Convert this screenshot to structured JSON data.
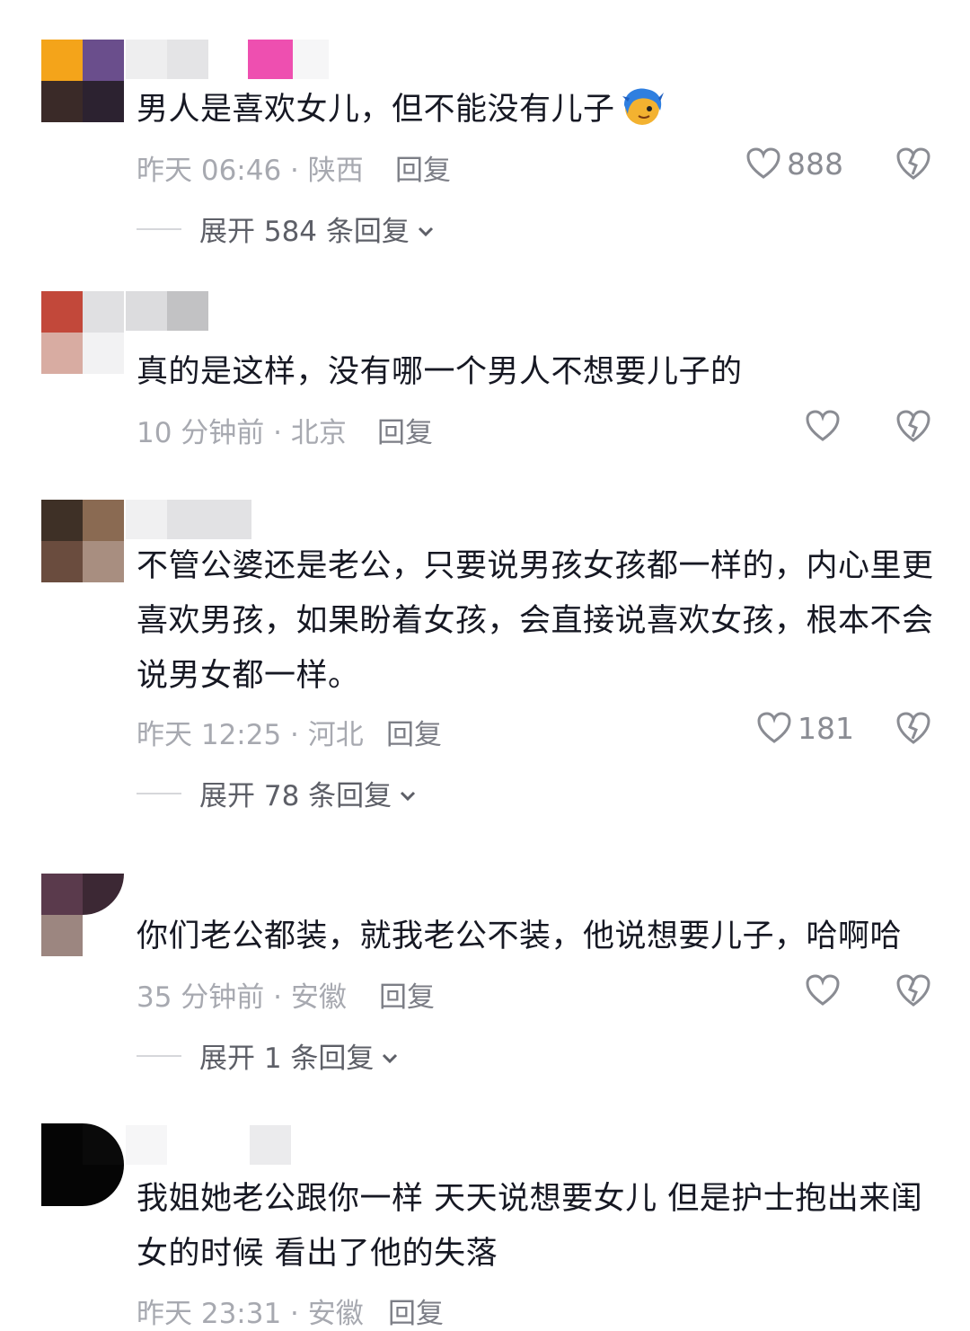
{
  "comments": [
    {
      "text": "男人是喜欢女儿，但不能没有儿子",
      "has_emoji": true,
      "meta": "昨天 06:46 · 陕西",
      "reply_label": "回复",
      "likes": "888",
      "expand_label": "展开 584 条回复",
      "avatar_colors": [
        "#f4a41a",
        "#6a4e8c",
        "#3a2a28",
        "#2c2230"
      ]
    },
    {
      "text": "真的是这样，没有哪一个男人不想要儿子的",
      "meta": "10 分钟前 · 北京",
      "reply_label": "回复",
      "likes": "",
      "avatar_colors": [
        "#c2483a",
        "#e0e0e2",
        "#d8aca2",
        "#f2f2f3"
      ]
    },
    {
      "text": "不管公婆还是老公，只要说男孩女孩都一样的，内心里更喜欢男孩，如果盼着女孩，会直接说喜欢女孩，根本不会说男女都一样。",
      "meta": "昨天 12:25 · 河北",
      "reply_label": "回复",
      "likes": "181",
      "expand_label": "展开 78 条回复",
      "avatar_colors": [
        "#3e3026",
        "#8a6a52",
        "#6a4c3e",
        "#a88e80"
      ]
    },
    {
      "text": "你们老公都装，就我老公不装，他说想要儿子，哈啊哈",
      "meta": "35 分钟前 · 安徽",
      "reply_label": "回复",
      "likes": "",
      "expand_label": "展开 1 条回复",
      "avatar_colors": [
        "#5a3a4c",
        "#3c2834",
        "#9c8680",
        "#ffffff"
      ]
    },
    {
      "text": "我姐她老公跟你一样  天天说想要女儿 但是护士抱出来闺女的时候  看出了他的失落",
      "meta": "昨天 23:31 · 安徽",
      "reply_label": "回复",
      "likes": "",
      "avatar_colors": [
        "#050505",
        "#0a0a0a",
        "#050505",
        "#ffffff"
      ]
    }
  ],
  "icons": {
    "like": "heart-outline-icon",
    "dislike": "broken-heart-icon",
    "expand": "chevron-down-icon",
    "emoji": "blue-hair-face-emoji"
  }
}
